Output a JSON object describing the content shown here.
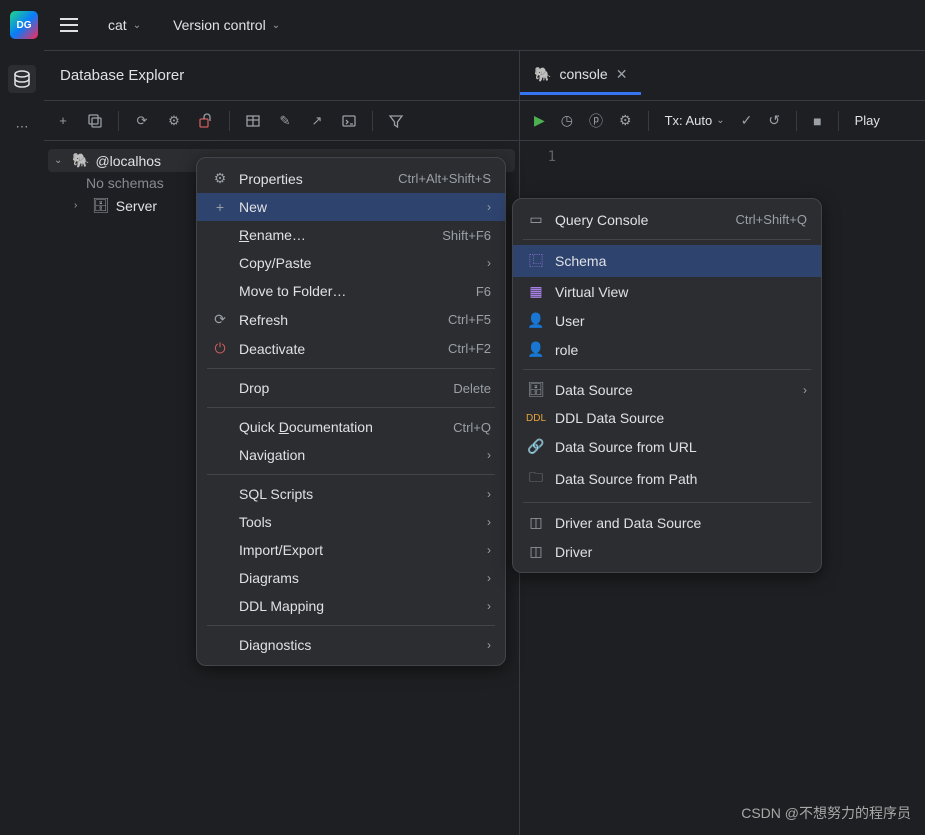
{
  "topbar": {
    "project": "cat",
    "vcs": "Version control"
  },
  "panel": {
    "title": "Database Explorer",
    "tree": {
      "source": "@localhos",
      "no_schemas": "No schemas",
      "server": "Server"
    }
  },
  "editor": {
    "tab": "console",
    "tx": "Tx: Auto",
    "play": "Play",
    "line": "1"
  },
  "menu1": {
    "properties": "Properties",
    "properties_sc": "Ctrl+Alt+Shift+S",
    "new": "New",
    "rename": "Rename…",
    "rename_sc": "Shift+F6",
    "copypaste": "Copy/Paste",
    "moveto": "Move to Folder…",
    "moveto_sc": "F6",
    "refresh": "Refresh",
    "refresh_sc": "Ctrl+F5",
    "deactivate": "Deactivate",
    "deactivate_sc": "Ctrl+F2",
    "drop": "Drop",
    "drop_sc": "Delete",
    "quickdoc": "Quick Documentation",
    "quickdoc_sc": "Ctrl+Q",
    "navigation": "Navigation",
    "sql": "SQL Scripts",
    "tools": "Tools",
    "impexp": "Import/Export",
    "diagrams": "Diagrams",
    "ddl": "DDL Mapping",
    "diag": "Diagnostics"
  },
  "menu2": {
    "qc": "Query Console",
    "qc_sc": "Ctrl+Shift+Q",
    "schema": "Schema",
    "vview": "Virtual View",
    "user": "User",
    "role": "role",
    "ds": "Data Source",
    "ddl_ds": "DDL Data Source",
    "ds_url": "Data Source from URL",
    "ds_path": "Data Source from Path",
    "drv_ds": "Driver and Data Source",
    "driver": "Driver"
  },
  "watermark": "CSDN @不想努力的程序员"
}
